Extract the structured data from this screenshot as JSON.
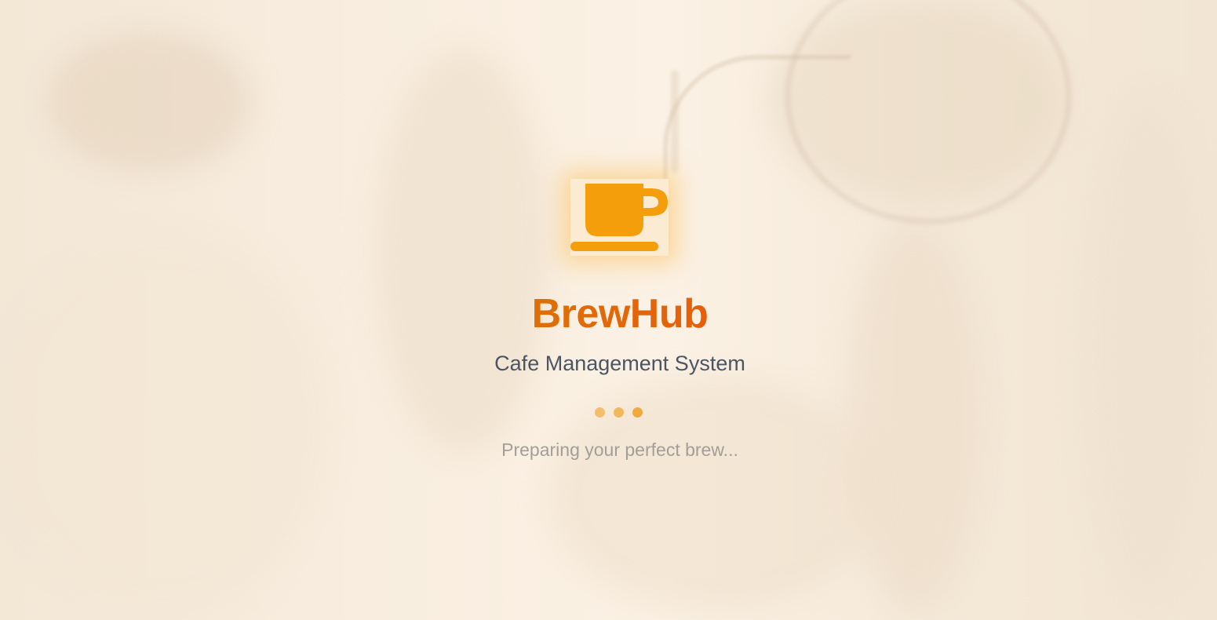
{
  "app": {
    "name": "BrewHub",
    "tagline": "Cafe Management System",
    "status_text": "Preparing your perfect brew...",
    "logo_icon": "coffee-cup-icon"
  },
  "loader": {
    "dot_count": 3
  },
  "colors": {
    "brand_primary": "#f59e0b",
    "brand_gradient_start": "#d97706",
    "brand_gradient_end": "#ea580c",
    "subtitle": "#4b5563",
    "status": "#a39e98",
    "background": "#f6ead9"
  }
}
